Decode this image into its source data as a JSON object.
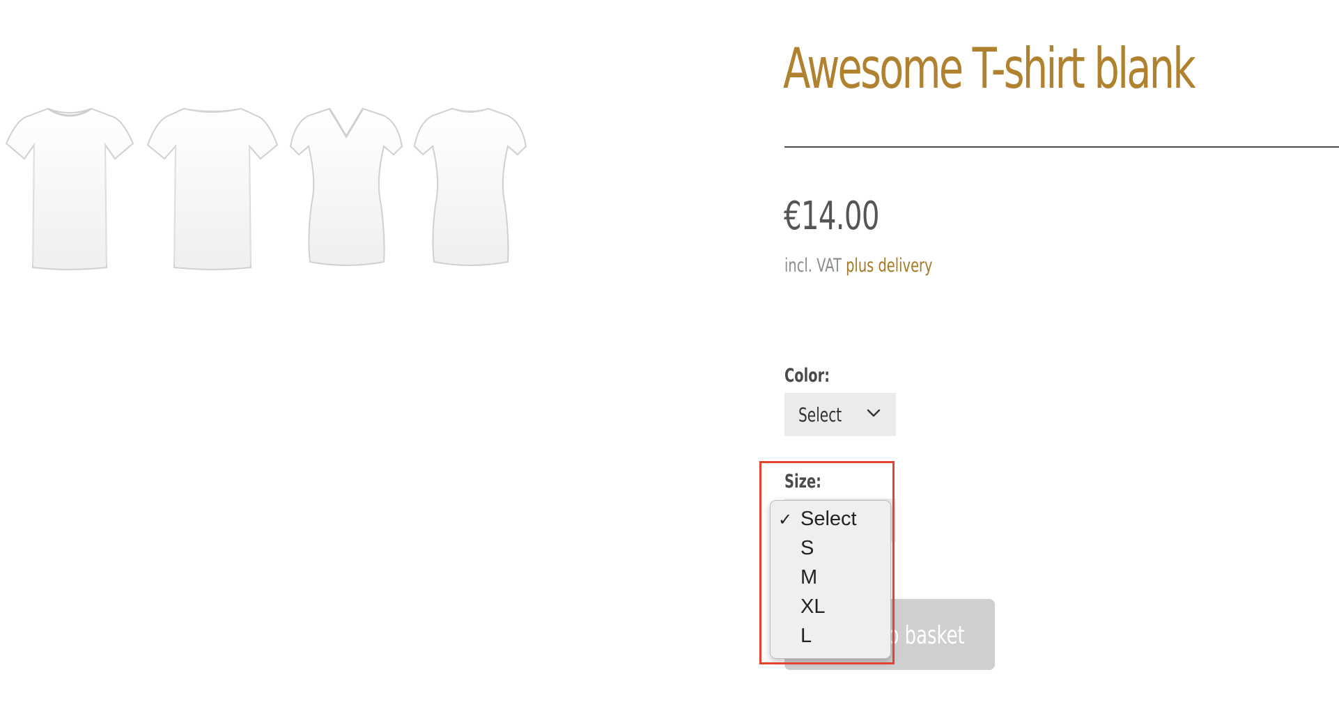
{
  "product": {
    "title": "Awesome T-shirt blank",
    "price": "€14.00",
    "vat_text": "incl. VAT",
    "delivery_link": "plus delivery"
  },
  "gallery": {
    "images": [
      {
        "name": "crew-neck-tshirt-image"
      },
      {
        "name": "boat-neck-tshirt-image"
      },
      {
        "name": "v-neck-women-tshirt-image"
      },
      {
        "name": "round-neck-women-tshirt-image"
      }
    ]
  },
  "options": {
    "color": {
      "label": "Color:",
      "selected": "Select",
      "icon": "chevron-down-icon"
    },
    "size": {
      "label": "Size:",
      "selected": "Select",
      "dropdown_open": true,
      "items": [
        "Select",
        "S",
        "M",
        "XL",
        "L"
      ],
      "checked_index": 0,
      "check_glyph": "✓"
    }
  },
  "basket_button": {
    "label": "Add to basket"
  },
  "colors": {
    "title": "#b0812f",
    "link": "#a57a26",
    "highlight": "#e2442f",
    "button_bg": "#cfcfcf"
  }
}
